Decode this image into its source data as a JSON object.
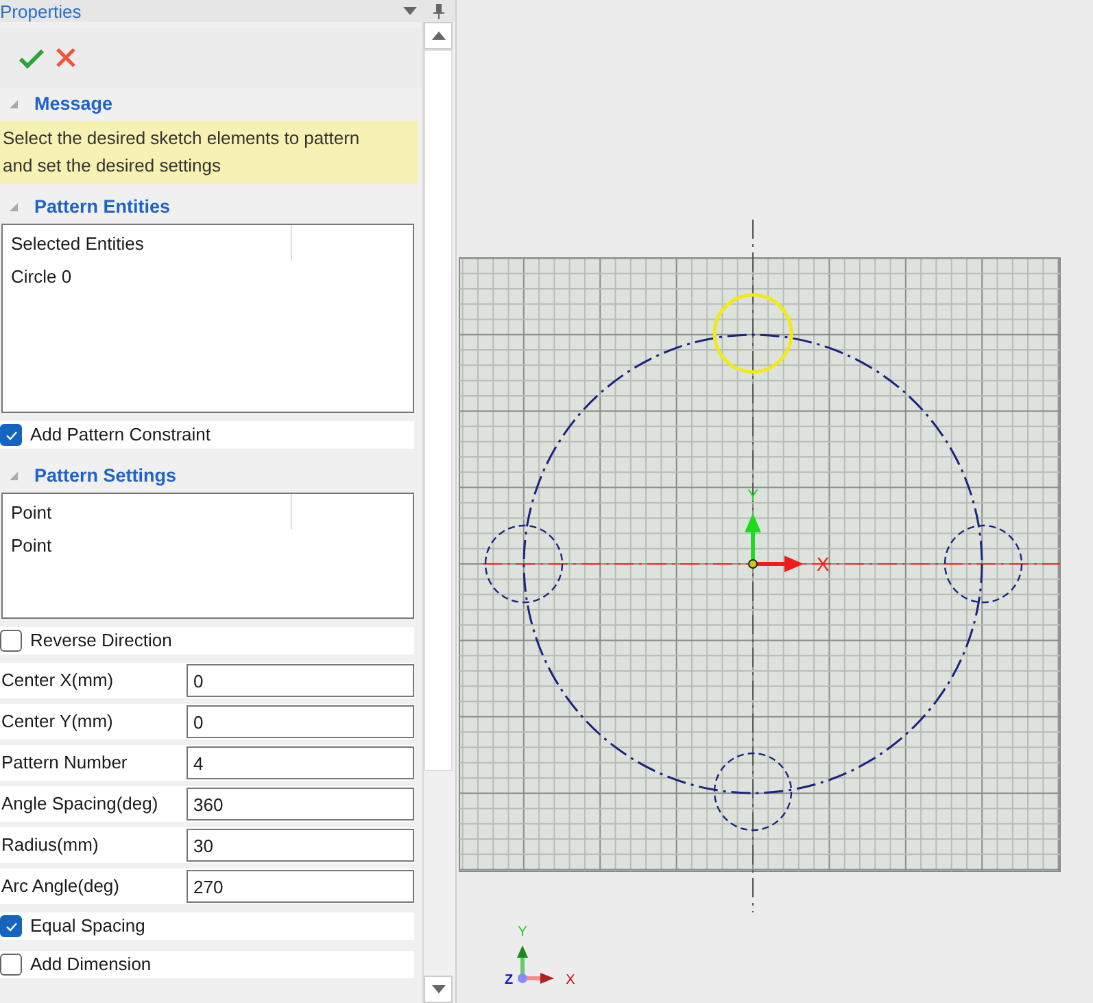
{
  "panel": {
    "title": "Properties"
  },
  "message": {
    "heading": "Message",
    "text": "Select the desired sketch elements to pattern and set the desired settings"
  },
  "entities": {
    "heading": "Pattern Entities",
    "items": [
      "Selected Entities",
      "Circle 0"
    ]
  },
  "constraint": {
    "label": "Add Pattern Constraint",
    "checked": true
  },
  "settings": {
    "heading": "Pattern Settings",
    "items": [
      "Point",
      "Point"
    ]
  },
  "rows": [
    {
      "kind": "checkbox",
      "label": "Reverse Direction",
      "checked": false
    },
    {
      "kind": "field",
      "label": "Center X(mm)",
      "value": "0"
    },
    {
      "kind": "field",
      "label": "Center Y(mm)",
      "value": "0"
    },
    {
      "kind": "field",
      "label": "Pattern Number",
      "value": "4"
    },
    {
      "kind": "field",
      "label": "Angle Spacing(deg)",
      "value": "360"
    },
    {
      "kind": "field",
      "label": "Radius(mm)",
      "value": "30"
    },
    {
      "kind": "field",
      "label": "Arc Angle(deg)",
      "value": "270"
    },
    {
      "kind": "checkbox",
      "label": "Equal Spacing",
      "checked": true
    },
    {
      "kind": "checkbox",
      "label": "Add Dimension",
      "checked": false
    }
  ],
  "sketch": {
    "circles": [
      {
        "selected": true
      },
      {
        "selected": false
      },
      {
        "selected": false
      },
      {
        "selected": false
      }
    ],
    "triad": {
      "x": "X",
      "y": "Y"
    },
    "view_triad": {
      "x": "X",
      "y": "Y",
      "z": "Z"
    }
  }
}
